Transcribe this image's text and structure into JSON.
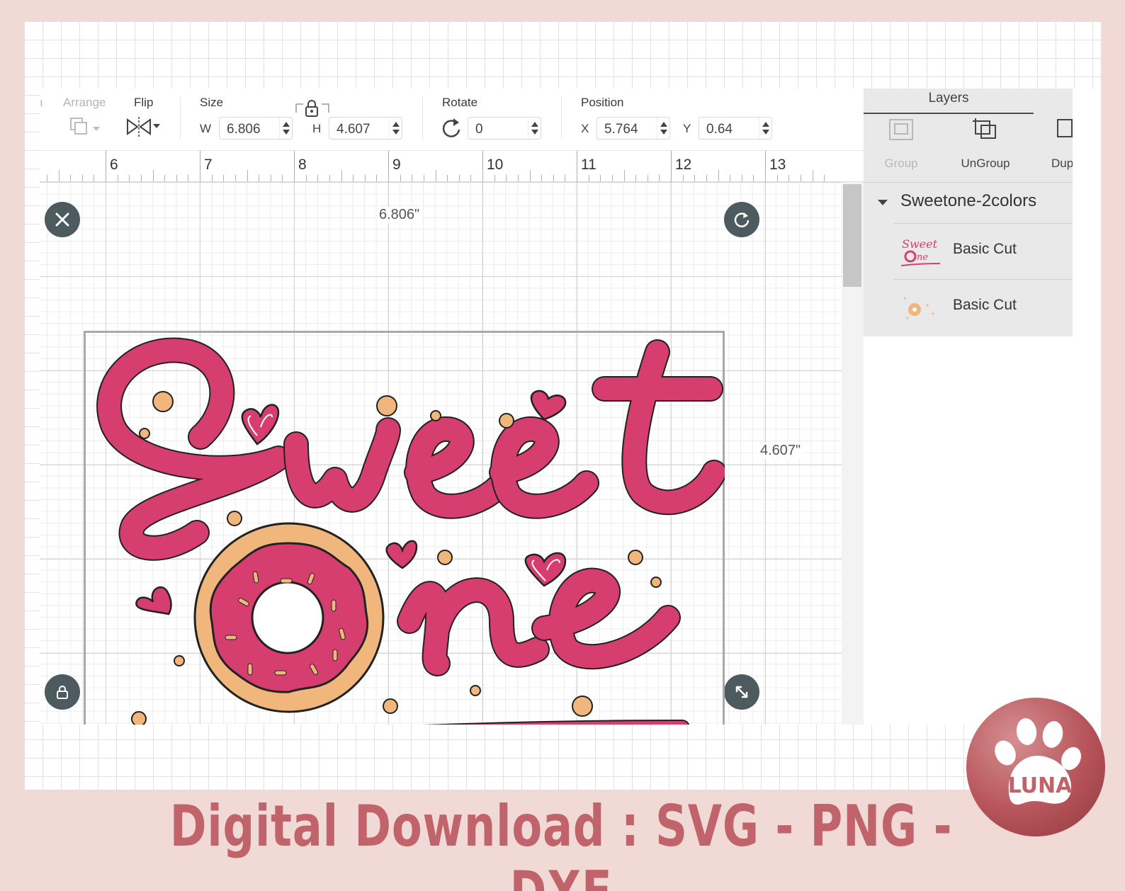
{
  "toolbar": {
    "arrange_label": "Arrange",
    "flip_label": "Flip",
    "size_label": "Size",
    "w_letter": "W",
    "w_value": "6.806",
    "h_letter": "H",
    "h_value": "4.607",
    "rotate_label": "Rotate",
    "rotate_value": "0",
    "position_label": "Position",
    "x_letter": "X",
    "x_value": "5.764",
    "y_letter": "Y",
    "y_value": "0.64"
  },
  "ruler": {
    "numbers": [
      "6",
      "7",
      "8",
      "9",
      "10",
      "11",
      "12",
      "13"
    ]
  },
  "canvas": {
    "width_label": "6.806\"",
    "height_label": "4.607\""
  },
  "layers": {
    "title": "Layers",
    "group_label": "Group",
    "ungroup_label": "UnGroup",
    "duplicate_label": "Dup",
    "group_name": "Sweetone-2colors",
    "items": [
      {
        "label": "Basic Cut"
      },
      {
        "label": "Basic Cut"
      }
    ]
  },
  "footer": {
    "text": "Digital Download : SVG - PNG - DXF"
  },
  "logo": {
    "text": "LUNA"
  },
  "colors": {
    "accent_pink": "#d63e70",
    "donut_dough": "#f0b67c",
    "page_bg": "#f1d9d6",
    "footer_text": "#c1636b",
    "handle": "#4d5b61"
  }
}
